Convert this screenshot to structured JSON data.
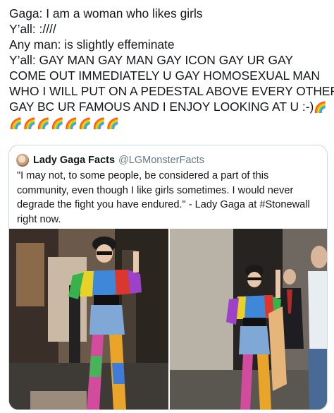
{
  "tweet": {
    "lines": [
      "Gaga: I am a woman who likes girls",
      "Y’all: :////",
      "Any man: is slightly effeminate",
      "Y’all: GAY MAN GAY MAN GAY ICON GAY UR GAY",
      "COME OUT IMMEDIATELY U GAY HOMOSEXUAL MAN",
      "WHO I WILL PUT ON A PEDESTAL ABOVE EVERY OTHER",
      "GAY BC UR FAMOUS AND I ENJOY LOOKING AT U :-)"
    ],
    "line7_emoji": "🌈",
    "emoji_row": "🌈🌈🌈🌈🌈🌈🌈🌈"
  },
  "quoted_tweet": {
    "name": "Lady Gaga Facts",
    "handle": "@LGMonsterFacts",
    "text": "\"I may not, to some people, be considered a part of this community, even though I like girls sometimes. I would never degrade the fight you have endured.\" - Lady Gaga at #Stonewall right now.",
    "photos": [
      "lady-gaga-photo-left",
      "lady-gaga-photo-right"
    ]
  },
  "colors": {
    "text": "#14171a",
    "secondary": "#657786",
    "border": "#ccd6dd"
  }
}
